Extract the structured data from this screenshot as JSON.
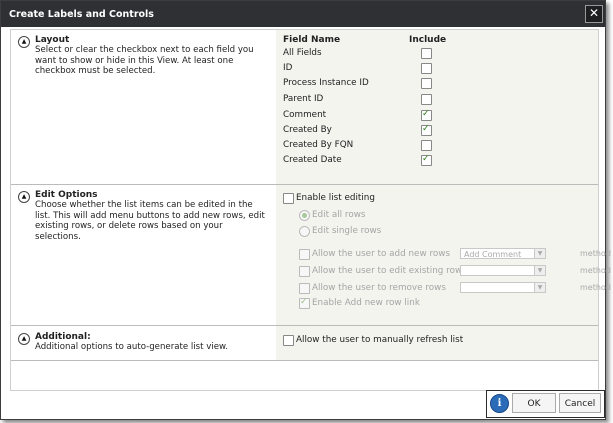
{
  "window": {
    "title": "Create Labels and Controls",
    "close_glyph": "✕"
  },
  "background": {
    "stub_text": "ns"
  },
  "layout": {
    "title": "Layout",
    "description": "Select or clear the checkbox next to each field you want to show or hide in this View. At least one checkbox must be selected.",
    "column_field_name": "Field Name",
    "column_include": "Include",
    "fields": [
      {
        "name": "All Fields",
        "checked": false
      },
      {
        "name": "ID",
        "checked": false
      },
      {
        "name": "Process Instance ID",
        "checked": false
      },
      {
        "name": "Parent ID",
        "checked": false
      },
      {
        "name": "Comment",
        "checked": true
      },
      {
        "name": "Created By",
        "checked": true
      },
      {
        "name": "Created By FQN",
        "checked": false
      },
      {
        "name": "Created Date",
        "checked": true
      }
    ]
  },
  "edit_options": {
    "title": "Edit Options",
    "description": "Choose whether the list items can be edited in the list. This will add menu buttons to add new rows, edit existing rows, or delete rows based on your selections.",
    "enable_list_editing": "Enable list editing",
    "edit_all_rows": "Edit all rows",
    "edit_single_rows": "Edit single rows",
    "allow_add": "Allow the user to add new rows",
    "allow_edit": "Allow the user to edit existing rows",
    "allow_remove": "Allow the user to remove rows",
    "enable_add_link": "Enable Add new row link",
    "add_method_value": "Add Comment",
    "method_label": "method"
  },
  "additional": {
    "title": "Additional:",
    "description": "Additional options to auto-generate list view.",
    "refresh_label": "Allow the user to manually refresh list"
  },
  "footer": {
    "info_glyph": "i",
    "ok_label": "OK",
    "cancel_label": "Cancel"
  },
  "icons": {
    "collapse_glyph": "▲",
    "dropdown_glyph": "▼"
  }
}
